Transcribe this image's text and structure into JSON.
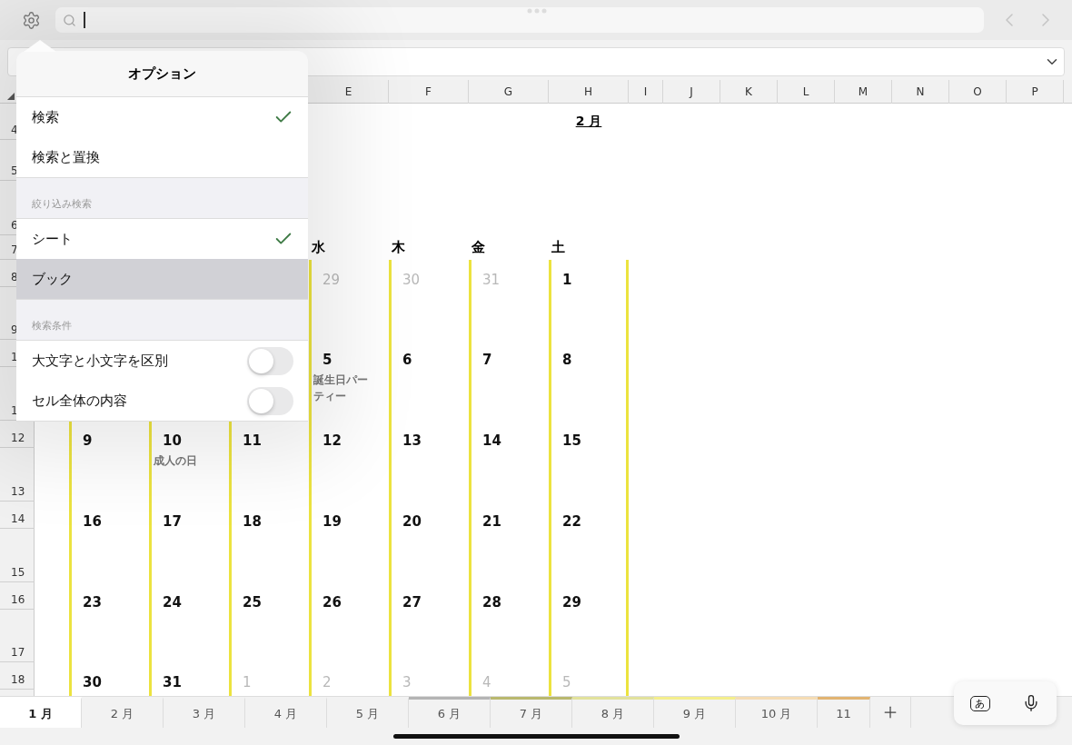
{
  "toolbar": {
    "back_disabled": true,
    "forward_disabled": true
  },
  "popover": {
    "title": "オプション",
    "sections": [
      {
        "items": [
          {
            "kind": "check",
            "label": "検索",
            "selected": true,
            "highlighted": false
          },
          {
            "kind": "check",
            "label": "検索と置換",
            "selected": false,
            "highlighted": false
          }
        ]
      },
      {
        "header": "絞り込み検索",
        "items": [
          {
            "kind": "check",
            "label": "シート",
            "selected": true,
            "highlighted": false
          },
          {
            "kind": "check",
            "label": "ブック",
            "selected": false,
            "highlighted": true
          }
        ]
      },
      {
        "header": "検索条件",
        "items": [
          {
            "kind": "toggle",
            "label": "大文字と小文字を区別",
            "on": false
          },
          {
            "kind": "toggle",
            "label": "セル全体の内容",
            "on": false
          }
        ]
      }
    ]
  },
  "sheet": {
    "columns": [
      "E",
      "F",
      "G",
      "H",
      "I",
      "J",
      "K",
      "L",
      "M",
      "N",
      "O",
      "P"
    ],
    "rows": [
      "4",
      "5",
      "6",
      "7",
      "8",
      "9",
      "1",
      "1",
      "12",
      "13",
      "14",
      "15",
      "16",
      "17",
      "18"
    ],
    "month_title": "2 月",
    "weekdays": [
      "水",
      "木",
      "金",
      "土"
    ],
    "weeks": [
      [
        {
          "day": "29",
          "muted": true
        },
        {
          "day": "30",
          "muted": true
        },
        {
          "day": "31",
          "muted": true
        },
        {
          "day": "1",
          "muted": false
        }
      ],
      [
        {
          "day": "5",
          "muted": false,
          "note": "誕生日パーティー"
        },
        {
          "day": "6",
          "muted": false
        },
        {
          "day": "7",
          "muted": false
        },
        {
          "day": "8",
          "muted": false
        }
      ],
      [
        {
          "day": "9",
          "muted": false
        },
        {
          "day": "10",
          "muted": false,
          "note": "成人の日"
        },
        {
          "day": "11",
          "muted": false
        },
        {
          "day": "12",
          "muted": false
        },
        {
          "day": "13",
          "muted": false
        },
        {
          "day": "14",
          "muted": false
        },
        {
          "day": "15",
          "muted": false
        }
      ],
      [
        {
          "day": "16",
          "muted": false
        },
        {
          "day": "17",
          "muted": false
        },
        {
          "day": "18",
          "muted": false
        },
        {
          "day": "19",
          "muted": false
        },
        {
          "day": "20",
          "muted": false
        },
        {
          "day": "21",
          "muted": false
        },
        {
          "day": "22",
          "muted": false
        }
      ],
      [
        {
          "day": "23",
          "muted": false
        },
        {
          "day": "24",
          "muted": false
        },
        {
          "day": "25",
          "muted": false
        },
        {
          "day": "26",
          "muted": false
        },
        {
          "day": "27",
          "muted": false
        },
        {
          "day": "28",
          "muted": false
        },
        {
          "day": "29",
          "muted": false
        }
      ],
      [
        {
          "day": "30",
          "muted": false
        },
        {
          "day": "31",
          "muted": false
        },
        {
          "day": "1",
          "muted": true
        },
        {
          "day": "2",
          "muted": true
        },
        {
          "day": "3",
          "muted": true
        },
        {
          "day": "4",
          "muted": true
        },
        {
          "day": "5",
          "muted": true
        }
      ]
    ]
  },
  "sheet_tabs": [
    {
      "label": "1 月",
      "selected": true
    },
    {
      "label": "2 月",
      "selected": false
    },
    {
      "label": "3 月",
      "selected": false
    },
    {
      "label": "4 月",
      "selected": false
    },
    {
      "label": "5 月",
      "selected": false
    },
    {
      "label": "6 月",
      "selected": false,
      "color": "#b4b4b4"
    },
    {
      "label": "7 月",
      "selected": false,
      "color": "#b9b86e"
    },
    {
      "label": "8 月",
      "selected": false,
      "color": "#e2e29c"
    },
    {
      "label": "9 月",
      "selected": false,
      "color": "#f4ee8c"
    },
    {
      "label": "10 月",
      "selected": false,
      "color": "#f5dcb4"
    },
    {
      "label": "11",
      "selected": false,
      "color": "#e2b472"
    }
  ],
  "keyboard_accessory": {
    "input_mode": "あ"
  }
}
